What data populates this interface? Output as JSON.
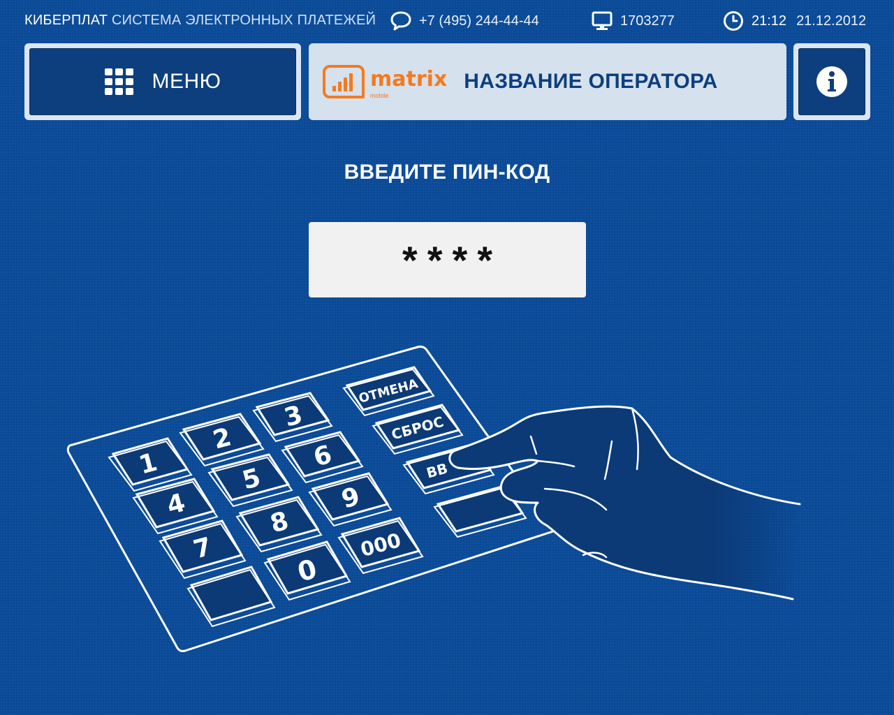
{
  "header": {
    "brand_main": "КИБЕРПЛАТ",
    "brand_sub": "СИСТЕМА ЭЛЕКТРОННЫХ ПЛАТЕЖЕЙ",
    "phone": "+7 (495) 244-44-44",
    "terminal_id": "1703277",
    "time": "21:12",
    "date": "21.12.2012"
  },
  "nav": {
    "menu_label": "МЕНЮ",
    "operator_logo_text": "matrix",
    "operator_logo_sub": "mobile",
    "operator_name": "НАЗВАНИЕ ОПЕРАТОРА"
  },
  "main": {
    "prompt": "ВВЕДИТЕ ПИН-КОД",
    "pin_masked": "****"
  },
  "illustration": {
    "keys": [
      "1",
      "2",
      "3",
      "4",
      "5",
      "6",
      "7",
      "8",
      "9",
      "0",
      "000"
    ],
    "side_keys": [
      "ОТМЕНА",
      "СБРОС",
      "ВВ"
    ]
  },
  "icons": [
    "chat-bubble-icon",
    "monitor-icon",
    "clock-icon",
    "grid-menu-icon",
    "signal-bars-icon",
    "info-icon",
    "keypad-illustration",
    "hand-illustration"
  ],
  "colors": {
    "background": "#0a4a97",
    "panel_light": "#d6e1ee",
    "button_dark": "#0d3f7e",
    "operator_orange": "#f47a1f"
  }
}
